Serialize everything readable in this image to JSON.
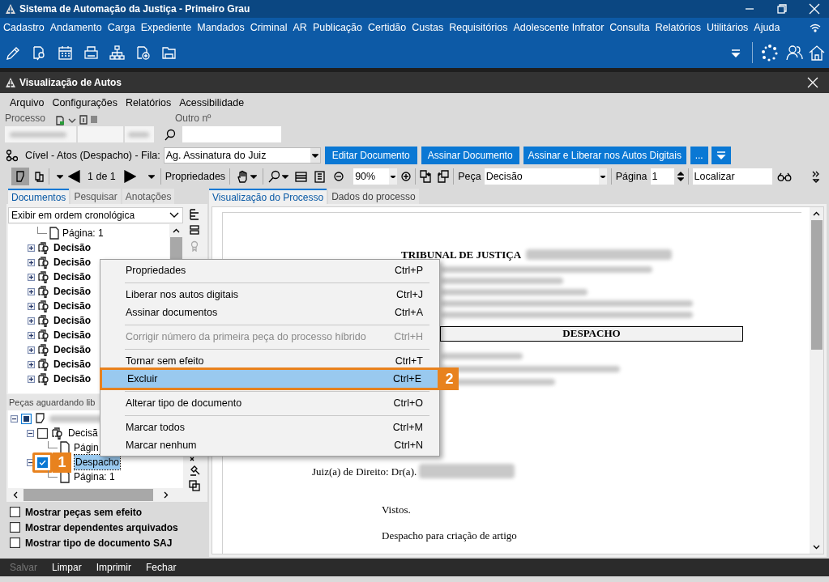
{
  "app_title": "Sistema de Automação da Justiça - Primeiro Grau",
  "main_menu": [
    "Cadastro",
    "Andamento",
    "Carga",
    "Expediente",
    "Mandados",
    "Criminal",
    "AR",
    "Publicação",
    "Certidão",
    "Custas",
    "Requisitórios",
    "Adolescente Infrator",
    "Consulta",
    "Relatórios",
    "Utilitários",
    "Ajuda"
  ],
  "window": {
    "title": "Visualização de Autos"
  },
  "menu": [
    "Arquivo",
    "Configurações",
    "Relatórios",
    "Acessibilidade"
  ],
  "process": {
    "label": "Processo",
    "other_label": "Outro nº"
  },
  "queue": {
    "label": "Cível - Atos (Despacho) - Fila:",
    "value": "Ag. Assinatura do Juiz"
  },
  "action_buttons": [
    "Editar Documento",
    "Assinar Documento",
    "Assinar e Liberar nos Autos Digitais",
    "..."
  ],
  "viewer_toolbar": {
    "page_count": "1 de 1",
    "properties": "Propriedades",
    "zoom": "90%",
    "piece_label": "Peça",
    "piece": "Decisão",
    "page_label": "Página",
    "page": "1",
    "find": "Localizar"
  },
  "left_tabs": [
    {
      "label": "Documentos",
      "selected": true
    },
    {
      "label": "Pesquisar",
      "selected": false
    },
    {
      "label": "Anotações",
      "selected": false
    }
  ],
  "order": "Exibir em ordem cronológica",
  "documents_tree": [
    {
      "label": "Página: 1",
      "kind": "page"
    },
    {
      "label": "Decisão",
      "kind": "signed",
      "expanded": false
    },
    {
      "label": "Decisão",
      "kind": "signed",
      "expanded": false
    },
    {
      "label": "Decisão",
      "kind": "signed",
      "expanded": false
    },
    {
      "label": "Decisão",
      "kind": "signed",
      "expanded": false
    },
    {
      "label": "Decisão",
      "kind": "signed",
      "expanded": false
    },
    {
      "label": "Decisão",
      "kind": "signed",
      "expanded": false
    },
    {
      "label": "Decisão",
      "kind": "signed",
      "expanded": false
    },
    {
      "label": "Decisão",
      "kind": "signed",
      "expanded": false
    },
    {
      "label": "Decisão",
      "kind": "signed",
      "expanded": false
    },
    {
      "label": "Decisão",
      "kind": "signed",
      "expanded": false
    }
  ],
  "pending": {
    "header": "Peças aguardando lib",
    "tree": [
      {
        "kind": "process",
        "partial": true,
        "expanded": true,
        "children": [
          {
            "label": "Decisã",
            "kind": "signed",
            "checked": false,
            "expanded": true,
            "children": [
              {
                "label": "Págin",
                "kind": "page"
              }
            ]
          },
          {
            "label": "Despacho",
            "kind": "doc",
            "checked": true,
            "selected": true,
            "expanded": true,
            "callout": "1",
            "children": [
              {
                "label": "Página: 1",
                "kind": "page"
              }
            ]
          }
        ]
      }
    ]
  },
  "options": [
    {
      "label": "Mostrar peças sem efeito",
      "checked": false
    },
    {
      "label": "Mostrar dependentes arquivados",
      "checked": false
    },
    {
      "label": "Mostrar tipo de documento SAJ",
      "checked": false
    }
  ],
  "doc_tabs": [
    {
      "label": "Visualização do Processo",
      "selected": true
    },
    {
      "label": "Dados do processo",
      "selected": false
    }
  ],
  "document": {
    "court": "TRIBUNAL DE JUSTIÇA",
    "heading": "DESPACHO",
    "judge": "Juiz(a) de Direito: Dr(a).",
    "paragraphs": [
      "Vistos.",
      "Despacho para criação de artigo"
    ]
  },
  "context_menu": [
    {
      "kind": "item",
      "label": "Propriedades",
      "shortcut": "Ctrl+P",
      "disabled": false,
      "selected": false
    },
    {
      "kind": "separator"
    },
    {
      "kind": "item",
      "label": "Liberar nos autos digitais",
      "shortcut": "Ctrl+J",
      "disabled": false,
      "selected": false
    },
    {
      "kind": "item",
      "label": "Assinar documentos",
      "shortcut": "Ctrl+A",
      "disabled": false,
      "selected": false
    },
    {
      "kind": "separator"
    },
    {
      "kind": "item",
      "label": "Corrigir número da primeira peça do processo híbrido",
      "shortcut": "Ctrl+H",
      "disabled": true,
      "selected": false
    },
    {
      "kind": "separator"
    },
    {
      "kind": "item",
      "label": "Tornar sem efeito",
      "shortcut": "Ctrl+T",
      "disabled": false,
      "selected": false
    },
    {
      "kind": "item",
      "label": "Excluir",
      "shortcut": "Ctrl+E",
      "disabled": false,
      "selected": true,
      "callout": "2"
    },
    {
      "kind": "separator"
    },
    {
      "kind": "item",
      "label": "Alterar tipo de documento",
      "shortcut": "Ctrl+O",
      "disabled": false,
      "selected": false
    },
    {
      "kind": "separator"
    },
    {
      "kind": "item",
      "label": "Marcar todos",
      "shortcut": "Ctrl+M",
      "disabled": false,
      "selected": false
    },
    {
      "kind": "item",
      "label": "Marcar nenhum",
      "shortcut": "Ctrl+N",
      "disabled": false,
      "selected": false
    }
  ],
  "bottom_buttons": [
    {
      "label": "Salvar",
      "disabled": true
    },
    {
      "label": "Limpar",
      "disabled": false
    },
    {
      "label": "Imprimir",
      "disabled": false
    },
    {
      "label": "Fechar",
      "disabled": false
    }
  ]
}
